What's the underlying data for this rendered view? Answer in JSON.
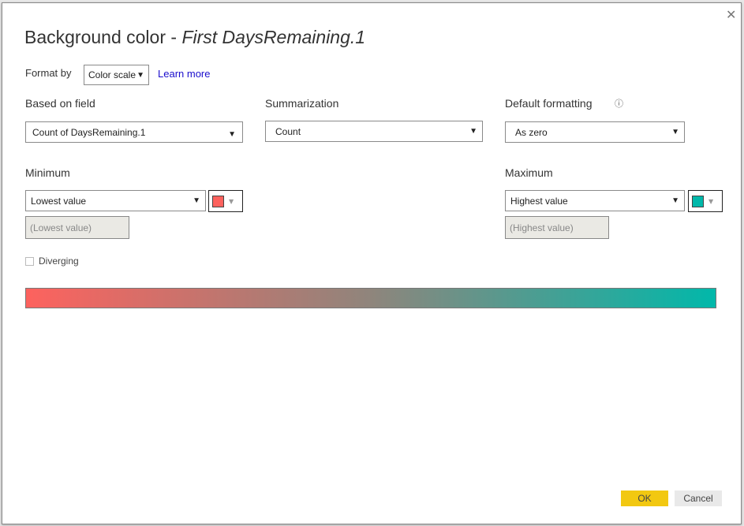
{
  "dialog": {
    "title_prefix": "Background color - ",
    "title_field": "First DaysRemaining.1",
    "format_by_label": "Format by",
    "format_by_value": "Color scale",
    "learn_more": "Learn more",
    "based_on_field_label": "Based on field",
    "based_on_field_value": "Count of DaysRemaining.1",
    "summarization_label": "Summarization",
    "summarization_value": "Count",
    "default_formatting_label": "Default formatting",
    "default_formatting_value": "As zero",
    "minimum": {
      "label": "Minimum",
      "value": "Lowest value",
      "placeholder": "(Lowest value)",
      "color": "#fd625e"
    },
    "maximum": {
      "label": "Maximum",
      "value": "Highest value",
      "placeholder": "(Highest value)",
      "color": "#01b8aa"
    },
    "diverging_label": "Diverging",
    "diverging_checked": false,
    "ok": "OK",
    "cancel": "Cancel",
    "ok_color": "#f2c811"
  }
}
